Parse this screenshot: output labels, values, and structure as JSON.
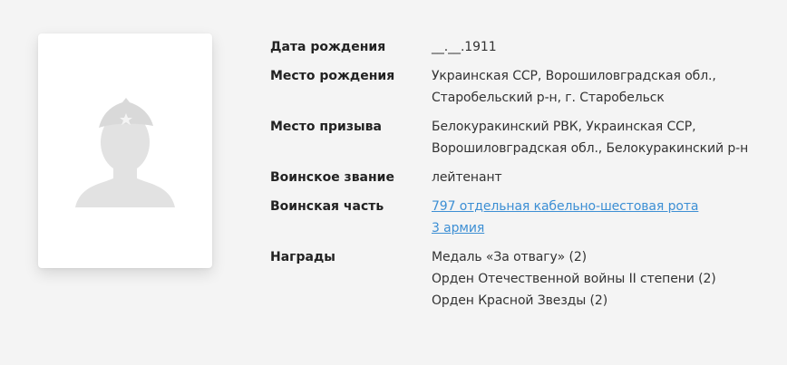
{
  "fields": [
    {
      "label": "Дата рождения",
      "lines": [
        "__.__.1911"
      ]
    },
    {
      "label": "Место рождения",
      "lines": [
        "Украинская ССР, Ворошиловградская обл.,",
        "Старобельский р-н, г. Старобельск"
      ]
    },
    {
      "label": "Место призыва",
      "lines": [
        "Белокуракинский РВК, Украинская ССР,",
        "Ворошиловградская обл., Белокуракинский р-н"
      ]
    },
    {
      "label": "Воинское звание",
      "lines": [
        "лейтенант"
      ]
    },
    {
      "label": "Воинская часть",
      "links": [
        "797 отдельная кабельно-шестовая рота",
        "3 армия"
      ]
    },
    {
      "label": "Награды",
      "lines": [
        "Медаль «За отвагу» (2)",
        "Орден Отечественной войны II степени (2)",
        "Орден Красной Звезды (2)"
      ]
    }
  ],
  "colors": {
    "background": "#f4f4f4",
    "card": "#ffffff",
    "link": "#3d8fd4",
    "silhouette": "#e2e2e2"
  },
  "icons": {
    "avatar": "soldier-silhouette-icon"
  }
}
